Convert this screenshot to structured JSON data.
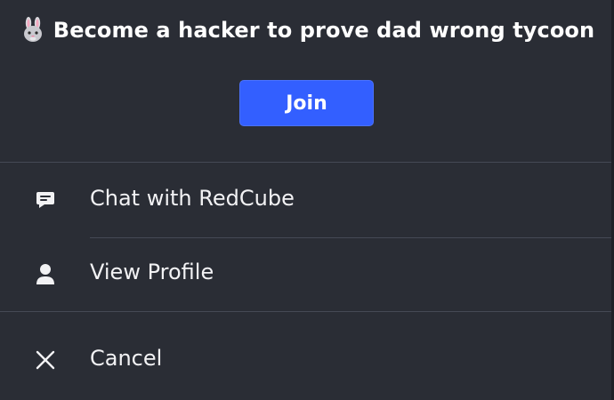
{
  "game": {
    "emoji_icon": "rabbit-face-icon",
    "title": "Become a hacker to prove dad wrong tycoon"
  },
  "join_button": {
    "label": "Join",
    "color": "#335fff"
  },
  "menu": {
    "items": [
      {
        "id": "chat",
        "icon": "chat-bubble-icon",
        "label": "Chat with RedCube"
      },
      {
        "id": "profile",
        "icon": "person-icon",
        "label": "View Profile"
      },
      {
        "id": "cancel",
        "icon": "close-icon",
        "label": "Cancel"
      }
    ]
  },
  "colors": {
    "background": "#2a2d35",
    "divider": "#454955",
    "text": "#f2f2f4"
  }
}
